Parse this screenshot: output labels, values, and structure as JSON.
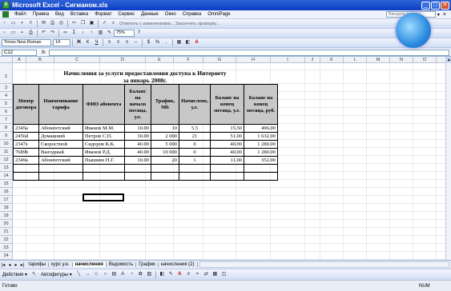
{
  "window": {
    "title": "Microsoft Excel - Сигманом.xls",
    "app_icon_letter": "X"
  },
  "menu": {
    "items": [
      "Файл",
      "Правка",
      "Вид",
      "Вставка",
      "Формат",
      "Сервис",
      "Данные",
      "Окно",
      "Справка",
      "OmniPage"
    ],
    "help_placeholder": "Введите вопрос"
  },
  "toolbar": {
    "review_text": "Ответить с изменениями...   Закончить проверку...",
    "zoom": "75%"
  },
  "format": {
    "font": "Times New Roman",
    "size": "14"
  },
  "formula": {
    "cell_ref": "C12",
    "fx": "fx"
  },
  "columns": [
    "A",
    "B",
    "C",
    "D",
    "E",
    "F",
    "G",
    "H",
    "I",
    "J",
    "K",
    "L",
    "M",
    "N",
    "O",
    "P"
  ],
  "rows": [
    "1",
    "2",
    "3",
    "4",
    "5",
    "6",
    "7",
    "8",
    "9",
    "10",
    "11",
    "12",
    "13",
    "14",
    "15",
    "16",
    "17",
    "18",
    "19",
    "20",
    "21",
    "22",
    "23",
    "24",
    "25",
    "26",
    "27"
  ],
  "sheet": {
    "title_line1": "Начисления за услуги предоставления доступа к Интернету",
    "title_line2": "за январь 2008г.",
    "headers": [
      "Номер договора",
      "Наименование тарифа",
      "ФИО абонента",
      "Баланс на начало месяца, у.е.",
      "Трафик, Mb",
      "Начислено, у.е.",
      "Баланс на конец месяца, у.е.",
      "Баланс на конец месяца, руб."
    ],
    "rows": [
      [
        "2345а",
        "Абонентский",
        "Иванов М.М.",
        "10.00",
        "10",
        "5.5",
        "15.50",
        "496.00"
      ],
      [
        "2456d",
        "Домашний",
        "Петров С.П.",
        "30.00",
        "2 000",
        "21",
        "51.00",
        "1 632.00"
      ],
      [
        "2347s",
        "Скоростной",
        "Сидоров К.К.",
        "40.00",
        "5 000",
        "0",
        "40.00",
        "1 280.00"
      ],
      [
        "7689b",
        "Выгодный",
        "Иванов Р.Д.",
        "40.00",
        "10 000",
        "0",
        "40.00",
        "1 280.00"
      ],
      [
        "2349а",
        "Абонентский",
        "Пышкин Н.Г.",
        "10.00",
        "20",
        "1",
        "11.00",
        "352.00"
      ]
    ]
  },
  "tabs": {
    "items": [
      "тарифы",
      "курс у.е.",
      "начисления",
      "Ведомость",
      "График",
      "начисления (2)"
    ],
    "active": "начисления"
  },
  "drawing": {
    "actions": "Действия ▾",
    "autoshapes": "Автофигуры ▾"
  },
  "status": {
    "text": "Готово",
    "num": "NUM"
  }
}
